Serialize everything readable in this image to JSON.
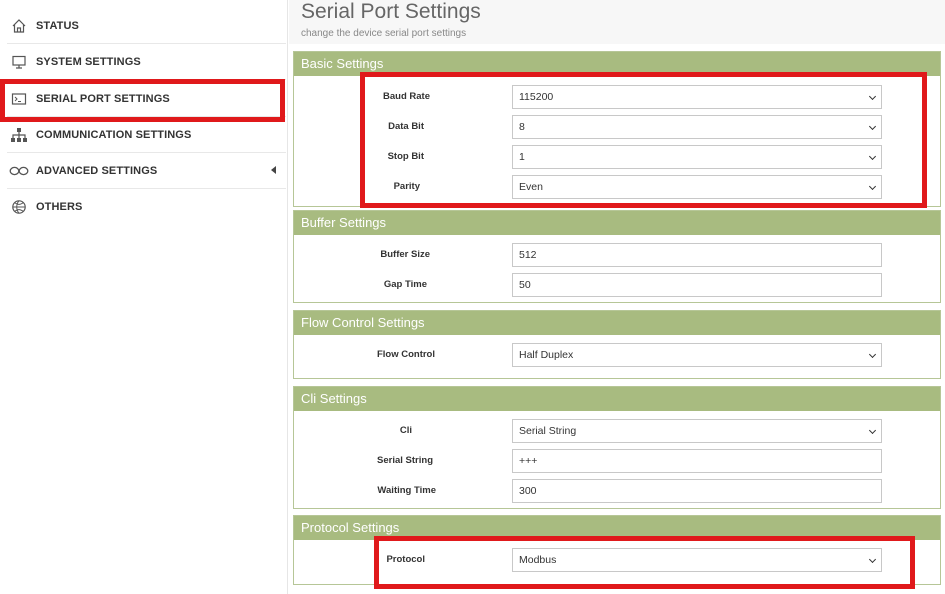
{
  "sidebar": {
    "items": [
      {
        "label": "STATUS",
        "icon": "home-icon"
      },
      {
        "label": "SYSTEM SETTINGS",
        "icon": "monitor-icon"
      },
      {
        "label": "SERIAL PORT SETTINGS",
        "icon": "terminal-icon"
      },
      {
        "label": "COMMUNICATION SETTINGS",
        "icon": "network-icon"
      },
      {
        "label": "ADVANCED SETTINGS",
        "icon": "infinity-icon"
      },
      {
        "label": "OTHERS",
        "icon": "basketball-icon"
      }
    ]
  },
  "header": {
    "title": "Serial Port Settings",
    "subtitle": "change the device serial port settings"
  },
  "sections": {
    "basic": {
      "title": "Basic Settings",
      "baud_rate": {
        "label": "Baud Rate",
        "value": "115200"
      },
      "data_bit": {
        "label": "Data Bit",
        "value": "8"
      },
      "stop_bit": {
        "label": "Stop Bit",
        "value": "1"
      },
      "parity": {
        "label": "Parity",
        "value": "Even"
      }
    },
    "buffer": {
      "title": "Buffer Settings",
      "buffer_size": {
        "label": "Buffer Size",
        "value": "512"
      },
      "gap_time": {
        "label": "Gap Time",
        "value": "50"
      }
    },
    "flow": {
      "title": "Flow Control Settings",
      "flow_control": {
        "label": "Flow Control",
        "value": "Half Duplex"
      }
    },
    "cli": {
      "title": "Cli Settings",
      "cli": {
        "label": "Cli",
        "value": "Serial String"
      },
      "serial_string": {
        "label": "Serial String",
        "value": "+++"
      },
      "waiting_time": {
        "label": "Waiting Time",
        "value": "300"
      }
    },
    "protocol": {
      "title": "Protocol Settings",
      "protocol": {
        "label": "Protocol",
        "value": "Modbus"
      }
    }
  },
  "colors": {
    "accent": "#a8bb80",
    "highlight": "#e0191b"
  }
}
